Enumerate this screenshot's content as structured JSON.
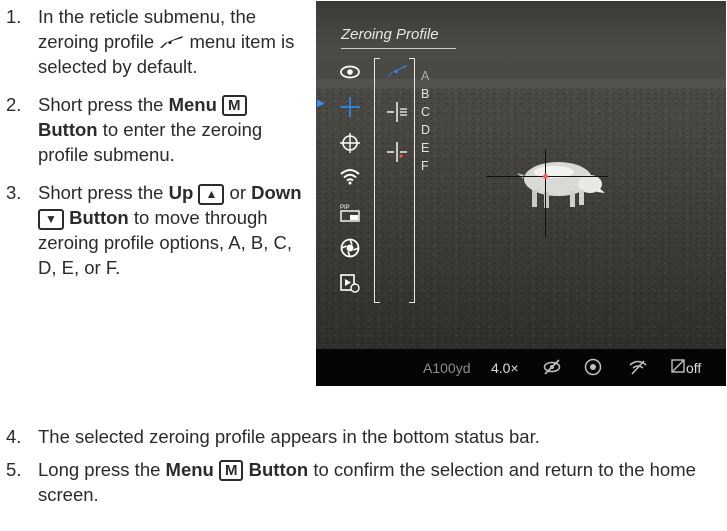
{
  "steps_top": [
    {
      "num": "1.",
      "before": "In the reticle submenu, the zeroing profile ",
      "after": " menu item is selected by default."
    },
    {
      "num": "2.",
      "before": "Short press the ",
      "bold": "Menu",
      "key": "M",
      "bold2": "Button",
      "after": " to enter the zeroing profile submenu."
    },
    {
      "num": "3.",
      "before": "Short press the ",
      "bold": "Up",
      "mid": " or ",
      "bold3": "Down",
      "bold2": "Button",
      "after": " to move through zeroing profile options, A, B, C, D, E, or F."
    }
  ],
  "steps_bottom": [
    {
      "num": "4.",
      "text": "The selected zeroing profile appears in the bottom status bar."
    },
    {
      "num": "5.",
      "before": "Long press the ",
      "bold": "Menu",
      "key": "M",
      "bold2": "Button",
      "after": " to confirm the selection and return to the home screen."
    }
  ],
  "screen": {
    "title": "Zeroing Profile",
    "profiles": [
      "A",
      "B",
      "C",
      "D",
      "E",
      "F"
    ],
    "menu_icons": [
      "eye-icon",
      "crosshair-icon",
      "target-icon",
      "wifi-icon",
      "pip-icon",
      "aperture-icon",
      "video-icon"
    ],
    "status": {
      "profile_range": "A100yd",
      "zoom": "4.0×",
      "record_off": "off"
    },
    "accent_color": "#2f8fff"
  }
}
